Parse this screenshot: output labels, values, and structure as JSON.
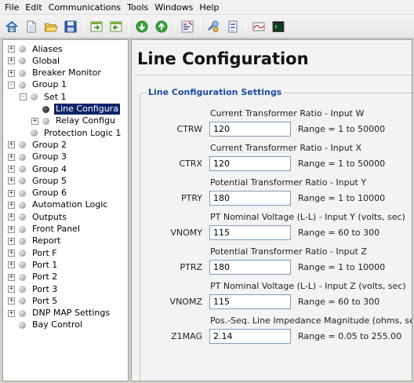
{
  "menu": [
    "File",
    "Edit",
    "Communications",
    "Tools",
    "Windows",
    "Help"
  ],
  "toolbar": {
    "buttons": [
      {
        "name": "home-icon"
      },
      {
        "name": "new-file-icon"
      },
      {
        "name": "open-folder-icon"
      },
      {
        "name": "save-disk-icon"
      },
      {
        "name": "import-icon"
      },
      {
        "name": "export-icon"
      },
      {
        "name": "download-icon"
      },
      {
        "name": "upload-icon"
      },
      {
        "name": "settings-compare-icon"
      },
      {
        "name": "tools-icon"
      },
      {
        "name": "report-icon"
      },
      {
        "name": "waveform-icon"
      },
      {
        "name": "terminal-icon"
      }
    ]
  },
  "tree": {
    "items": [
      {
        "label": "Aliases",
        "expander": "+"
      },
      {
        "label": "Global",
        "expander": "+"
      },
      {
        "label": "Breaker Monitor",
        "expander": "+"
      },
      {
        "label": "Group 1",
        "expander": "-"
      },
      {
        "label": "Set 1",
        "expander": "-"
      },
      {
        "label": "Line Configura",
        "expander": "",
        "selected": true
      },
      {
        "label": "Relay Configu",
        "expander": "+"
      },
      {
        "label": "Protection Logic 1",
        "expander": ""
      },
      {
        "label": "Group 2",
        "expander": "+"
      },
      {
        "label": "Group 3",
        "expander": "+"
      },
      {
        "label": "Group 4",
        "expander": "+"
      },
      {
        "label": "Group 5",
        "expander": "+"
      },
      {
        "label": "Group 6",
        "expander": "+"
      },
      {
        "label": "Automation Logic",
        "expander": "+"
      },
      {
        "label": "Outputs",
        "expander": "+"
      },
      {
        "label": "Front Panel",
        "expander": "+"
      },
      {
        "label": "Report",
        "expander": "+"
      },
      {
        "label": "Port F",
        "expander": "+"
      },
      {
        "label": "Port 1",
        "expander": "+"
      },
      {
        "label": "Port 2",
        "expander": "+"
      },
      {
        "label": "Port 3",
        "expander": "+"
      },
      {
        "label": "Port 5",
        "expander": "+"
      },
      {
        "label": "DNP MAP Settings",
        "expander": "+"
      },
      {
        "label": "Bay Control",
        "expander": ""
      }
    ]
  },
  "page": {
    "title": "Line Configuration",
    "section_title": "Line Configuration Settings"
  },
  "fields": [
    {
      "tag": "CTRW",
      "desc": "Current Transformer Ratio - Input W",
      "value": "120",
      "range": "Range = 1 to 50000"
    },
    {
      "tag": "CTRX",
      "desc": "Current Transformer Ratio - Input X",
      "value": "120",
      "range": "Range = 1 to 50000"
    },
    {
      "tag": "PTRY",
      "desc": "Potential Transformer Ratio - Input Y",
      "value": "180",
      "range": "Range = 1 to 10000"
    },
    {
      "tag": "VNOMY",
      "desc": "PT Nominal Voltage (L-L) - Input Y (volts, sec)",
      "value": "115",
      "range": "Range = 60 to 300"
    },
    {
      "tag": "PTRZ",
      "desc": "Potential Transformer Ratio - Input Z",
      "value": "180",
      "range": "Range = 1 to 10000"
    },
    {
      "tag": "VNOMZ",
      "desc": "PT Nominal Voltage (L-L) - Input Z (volts, sec)",
      "value": "115",
      "range": "Range = 60 to 300"
    },
    {
      "tag": "Z1MAG",
      "desc": "Pos.-Seq. Line Impedance Magnitude (ohms, sec)",
      "value": "2.14",
      "range": "Range = 0.05 to 255.00"
    }
  ],
  "colors": {
    "accent": "#1c4b9c",
    "selection": "#0a246a"
  }
}
